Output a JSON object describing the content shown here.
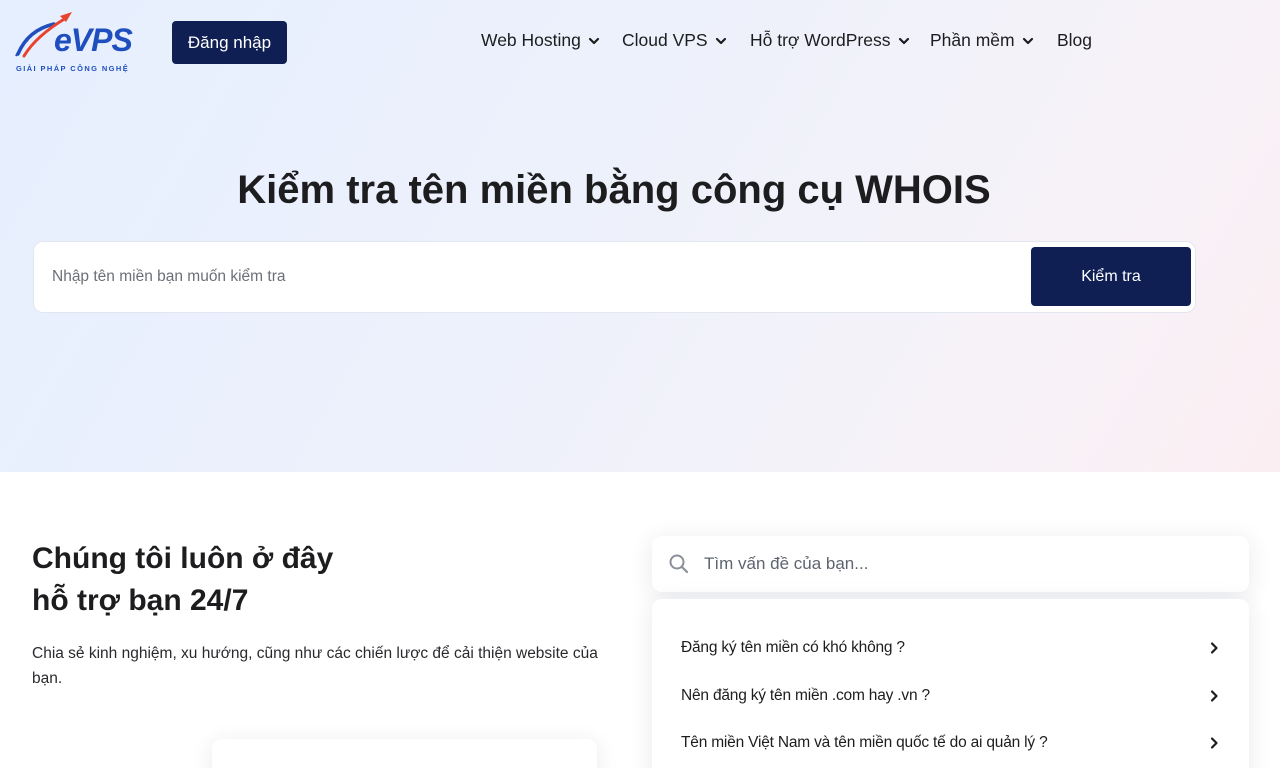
{
  "header": {
    "logo_text": "eVPS",
    "logo_tagline": "GIẢI PHÁP CÔNG NGHỆ",
    "login_label": "Đăng nhập",
    "nav": [
      {
        "label": "Web Hosting",
        "has_dropdown": true
      },
      {
        "label": "Cloud VPS",
        "has_dropdown": true
      },
      {
        "label": "Hỗ trợ WordPress",
        "has_dropdown": true
      },
      {
        "label": "Phần mềm",
        "has_dropdown": true
      },
      {
        "label": "Blog",
        "has_dropdown": false
      }
    ]
  },
  "hero": {
    "title": "Kiểm tra tên miền bằng công cụ WHOIS",
    "search_placeholder": "Nhập tên miền bạn muốn kiểm tra",
    "search_button": "Kiểm tra"
  },
  "support": {
    "title_line1": "Chúng tôi luôn ở đây",
    "title_line2": "hỗ trợ bạn 24/7",
    "description": "Chia sẻ kinh nghiệm, xu hướng, cũng như các chiến lược để cải thiện website của bạn."
  },
  "faq": {
    "search_placeholder": "Tìm vấn đề của bạn...",
    "items": [
      {
        "label": "Đăng ký tên miền có khó không ?"
      },
      {
        "label": "Nên đăng ký tên miền .com hay .vn ?"
      },
      {
        "label": "Tên miền Việt Nam và tên miền quốc tế do ai quản lý ?"
      }
    ]
  },
  "colors": {
    "brand_navy": "#0f1f54",
    "logo_blue": "#1f4fbf",
    "logo_red": "#e8432f"
  },
  "icons": [
    "logo-swoosh-icon",
    "chevron-down-icon",
    "search-icon",
    "chevron-right-icon"
  ]
}
